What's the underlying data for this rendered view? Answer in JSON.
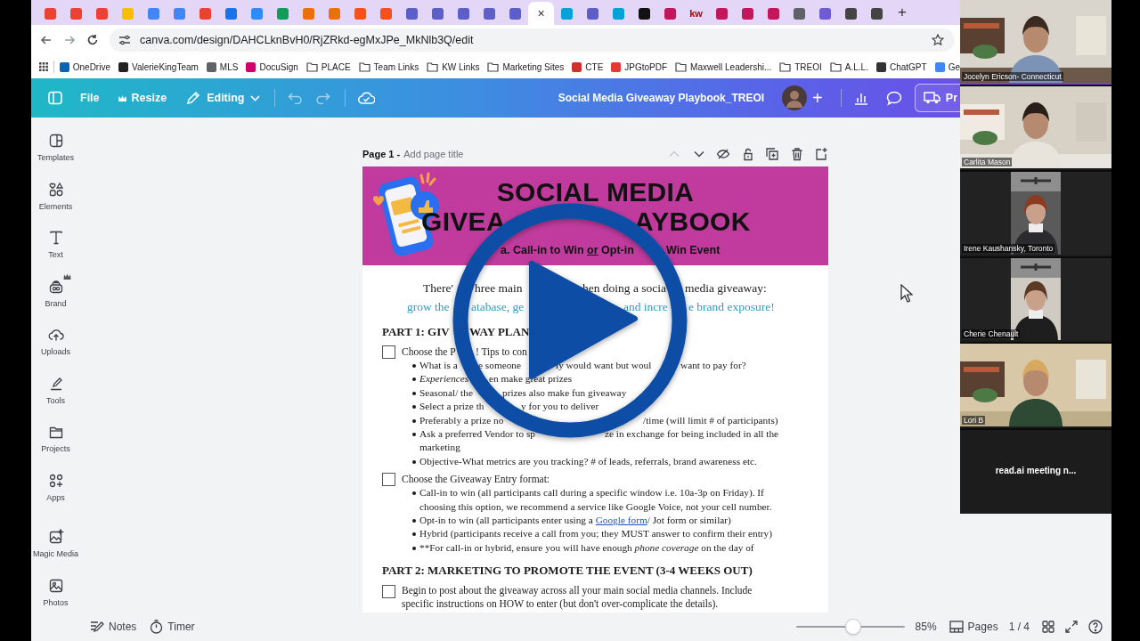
{
  "browser": {
    "tabs": [
      {
        "color": "#ea4335",
        "selected": false
      },
      {
        "color": "#ea4335",
        "selected": false
      },
      {
        "color": "#ea4335",
        "selected": false
      },
      {
        "color": "#fbbc04",
        "selected": false
      },
      {
        "color": "#4285f4",
        "selected": false
      },
      {
        "color": "#4285f4",
        "selected": false
      },
      {
        "color": "#ea4335",
        "selected": false
      },
      {
        "color": "#1a73e8",
        "selected": false
      },
      {
        "color": "#2d8cff",
        "selected": false
      },
      {
        "color": "#0f9d58",
        "selected": false
      },
      {
        "color": "#e8710a",
        "selected": false
      },
      {
        "color": "#e8710a",
        "selected": false
      },
      {
        "color": "#f4511e",
        "selected": false
      },
      {
        "color": "#f4511e",
        "selected": false
      },
      {
        "color": "#5b5fc7",
        "selected": false
      },
      {
        "color": "#5b5fc7",
        "selected": false
      },
      {
        "color": "#5b5fc7",
        "selected": false
      },
      {
        "color": "#5b5fc7",
        "selected": false
      },
      {
        "color": "#5b5fc7",
        "selected": false
      },
      {
        "selected": true,
        "close": "×"
      },
      {
        "color": "#00a3d8",
        "selected": false
      },
      {
        "color": "#5b5fc7",
        "selected": false
      },
      {
        "color": "#00a3d8",
        "selected": false
      },
      {
        "color": "#111111",
        "selected": false
      },
      {
        "color": "#c2185b",
        "selected": false
      },
      {
        "color": "#b40101",
        "selected": false,
        "label": "kw"
      },
      {
        "color": "#c2185b",
        "selected": false
      },
      {
        "color": "#c2185b",
        "selected": false
      },
      {
        "color": "#c2185b",
        "selected": false
      },
      {
        "color": "#5f6368",
        "selected": false
      },
      {
        "color": "#6f5bd3",
        "selected": false
      },
      {
        "color": "#444444",
        "selected": false
      },
      {
        "color": "#444444",
        "selected": false
      }
    ],
    "new_tab": "+",
    "url": "canva.com/design/DAHCLknBvH0/RjZRkd-egMxJPe_MkNlb3Q/edit",
    "bookmarks": [
      {
        "label": "OneDrive",
        "kind": "site",
        "color": "#0364b8"
      },
      {
        "label": "ValerieKingTeam",
        "kind": "site",
        "color": "#222222"
      },
      {
        "label": "MLS",
        "kind": "site",
        "color": "#5f6368"
      },
      {
        "label": "DocuSign",
        "kind": "site",
        "color": "#d1006b"
      },
      {
        "label": "PLACE",
        "kind": "folder"
      },
      {
        "label": "Team Links",
        "kind": "folder"
      },
      {
        "label": "KW Links",
        "kind": "folder"
      },
      {
        "label": "Marketing Sites",
        "kind": "folder"
      },
      {
        "label": "CTE",
        "kind": "site",
        "color": "#d32f2f"
      },
      {
        "label": "JPGtoPDF",
        "kind": "site",
        "color": "#e53935"
      },
      {
        "label": "Maxwell Leadershi...",
        "kind": "folder"
      },
      {
        "label": "TREOI",
        "kind": "folder"
      },
      {
        "label": "A.L.L.",
        "kind": "folder"
      },
      {
        "label": "ChatGPT",
        "kind": "site",
        "color": "#333333"
      },
      {
        "label": "Ge",
        "kind": "site",
        "color": "#4285f4"
      }
    ]
  },
  "toolbar": {
    "file": "File",
    "resize": "Resize",
    "mode": "Editing",
    "title": "Social Media Giveaway Playbook_TREOI",
    "add": "+",
    "present": "Pr"
  },
  "sidebar": [
    {
      "label": "Templates",
      "premium": false
    },
    {
      "label": "Elements",
      "premium": false
    },
    {
      "label": "Text",
      "premium": false
    },
    {
      "label": "Brand",
      "premium": true
    },
    {
      "label": "Uploads",
      "premium": false
    },
    {
      "label": "Tools",
      "premium": false
    },
    {
      "label": "Projects",
      "premium": false
    },
    {
      "label": "Apps",
      "premium": false
    },
    {
      "label": "Magic Media",
      "premium": false
    },
    {
      "label": "Photos",
      "premium": false
    }
  ],
  "page": {
    "label": "Page 1 -",
    "title_placeholder": "Add page title",
    "actions": [
      {
        "disabled": true
      },
      {
        "disabled": false
      },
      {
        "disabled": false
      },
      {
        "disabled": false
      },
      {
        "disabled": false
      },
      {
        "disabled": false
      },
      {
        "disabled": false
      }
    ],
    "lines": [
      {
        "kind": "title",
        "parts": [
          {
            "text": "SOCIAL MEDIA"
          }
        ]
      },
      {
        "kind": "title",
        "parts": [
          {
            "text": "GIVEA"
          },
          {
            "text": "AYBOOK"
          }
        ]
      },
      {
        "kind": "subtitle",
        "parts": [
          {
            "text": "a. Call-in to Win "
          },
          {
            "text": "or",
            "kind": "underline"
          },
          {
            "text": " Opt-in"
          },
          {
            "text": "Win Event"
          }
        ]
      },
      {
        "kind": "intro",
        "parts": [
          {
            "text": "There'"
          },
          {
            "text": "hree main"
          },
          {
            "text": "hen doing a socia"
          },
          {
            "text": "media giveaway:"
          }
        ]
      },
      {
        "kind": "tagline",
        "parts": [
          {
            "text": "grow the"
          },
          {
            "text": "atabase, ge"
          },
          {
            "text": "and incre"
          },
          {
            "text": "e brand exposure!"
          }
        ]
      },
      {
        "kind": "heading",
        "parts": [
          {
            "text": "PART 1: GIV"
          },
          {
            "text": "WAY PLAN"
          }
        ]
      },
      {
        "kind": "check",
        "checked": false,
        "parts": [
          {
            "text": "Choose the P"
          },
          {
            "text": "! Tips to con"
          }
        ]
      },
      {
        "kind": "bullet",
        "parts": [
          {
            "text": "What is a"
          },
          {
            "text": "e someone"
          },
          {
            "text": "ly would want but woul"
          },
          {
            "text": "want to pay for?"
          }
        ]
      },
      {
        "kind": "bullet",
        "parts": [
          {
            "text": "Experiences",
            "kind": "italic"
          },
          {
            "text": "en make great prizes"
          }
        ]
      },
      {
        "kind": "bullet",
        "parts": [
          {
            "text": "Seasonal/ the"
          },
          {
            "text": "prizes also make fun giveaway"
          }
        ]
      },
      {
        "kind": "bullet",
        "parts": [
          {
            "text": "Select a prize th"
          },
          {
            "text": "y for you to deliver"
          }
        ]
      },
      {
        "kind": "bullet",
        "parts": [
          {
            "text": "Preferably a prize no"
          },
          {
            "text": "/time (will limit # of participants)"
          }
        ]
      },
      {
        "kind": "bullet",
        "parts": [
          {
            "text": "Ask a preferred Vendor to sp"
          },
          {
            "text": "ze in exchange for being included in all the"
          }
        ]
      },
      {
        "kind": "continuation",
        "parts": [
          {
            "text": "marketing"
          }
        ]
      },
      {
        "kind": "bullet",
        "parts": [
          {
            "text": "Objective-What metrics are you tracking? # of leads, referrals, brand awareness etc."
          }
        ]
      },
      {
        "kind": "check",
        "checked": false,
        "parts": [
          {
            "text": "Choose the Giveaway Entry format:"
          }
        ]
      },
      {
        "kind": "bullet",
        "parts": [
          {
            "text": "Call-in to win (all participants call during a specific window i.e. 10a-3p on Friday). If choosing this option, we recommend a service like Google Voice, not your cell number."
          }
        ]
      },
      {
        "kind": "bullet",
        "parts": [
          {
            "text": "Opt-in to win (all participants enter using a "
          },
          {
            "text": "Google form",
            "kind": "link"
          },
          {
            "text": "/ Jot form or similar)"
          }
        ]
      },
      {
        "kind": "bullet",
        "parts": [
          {
            "text": "Hybrid (participants receive a call from you; they MUST answer to confirm their entry)"
          }
        ]
      },
      {
        "kind": "bullet",
        "parts": [
          {
            "text": "**For call-in or hybrid, ensure you will have enough "
          },
          {
            "text": "phone coverage",
            "kind": "italic"
          },
          {
            "text": " on the day of"
          }
        ]
      },
      {
        "kind": "heading",
        "parts": [
          {
            "text": "PART 2: MARKETING TO PROMOTE THE EVENT (3-4 WEEKS OUT)"
          }
        ]
      },
      {
        "kind": "check",
        "checked": false,
        "parts": [
          {
            "text": "Begin to post about the giveaway across all your main social media channels. Include specific instructions on HOW to enter (but don't over-complicate the details)."
          }
        ]
      }
    ]
  },
  "footer": {
    "notes": "Notes",
    "timer": "Timer",
    "zoom": {
      "level": 0.53
    },
    "zoom_reading": "85%",
    "pages": "Pages",
    "page_count": "1 / 4"
  },
  "participants": [
    {
      "kind": "room",
      "name": "Jocelyn Ericson- Connecticut",
      "speaking": true
    },
    {
      "kind": "room",
      "name": "Carlita Mason",
      "speaking": false
    },
    {
      "kind": "portrait",
      "name": "Irene Kaushansky, Toronto",
      "speaking": false
    },
    {
      "kind": "portrait",
      "name": "Cherie Chenault",
      "speaking": false
    },
    {
      "kind": "room",
      "name": "Lori B",
      "speaking": false
    },
    {
      "kind": "caption",
      "name": "read.ai meeting n...",
      "speaking": false
    }
  ]
}
